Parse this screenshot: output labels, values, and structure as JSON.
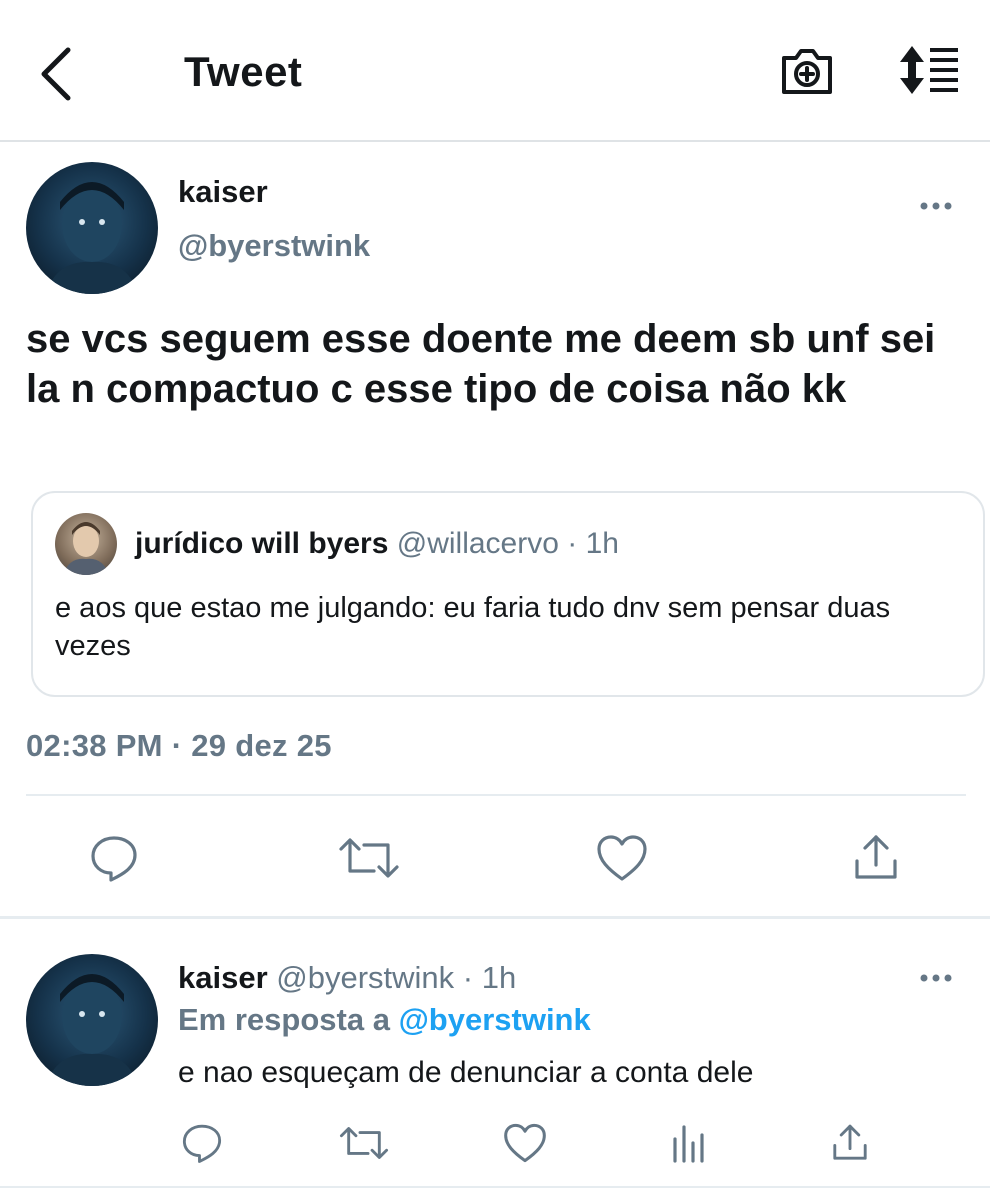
{
  "header": {
    "title": "Tweet",
    "icons": [
      "chevron-left-icon",
      "camera-plus-icon",
      "sort-icon"
    ]
  },
  "tweet": {
    "author_name": "kaiser",
    "author_handle": "@byerstwink",
    "text": "se vcs seguem esse doente me deem sb unf sei la n compactuo c esse tipo de coisa não kk",
    "quoted": {
      "author_name": "jurídico will byers",
      "author_handle": "@willacervo",
      "separator": "·",
      "time": "1h",
      "text": "e aos que estao me julgando: eu faria tudo dnv sem pensar duas vezes"
    },
    "timestamp": "02:38 PM · 29 dez 25",
    "actions": [
      "reply-icon",
      "retweet-icon",
      "like-icon",
      "share-icon"
    ]
  },
  "reply": {
    "author_name": "kaiser",
    "author_handle": "@byerstwink",
    "separator": "·",
    "time": "1h",
    "in_reply_prefix": "Em resposta a",
    "in_reply_handle": "@byerstwink",
    "text": "e nao esqueçam de denunciar a conta dele",
    "actions": [
      "reply-icon",
      "retweet-icon",
      "like-icon",
      "analytics-icon",
      "share-icon"
    ]
  },
  "colors": {
    "text": "#14171a",
    "secondary": "#657786",
    "link": "#1da1f2",
    "divider": "#e6ecf0"
  }
}
